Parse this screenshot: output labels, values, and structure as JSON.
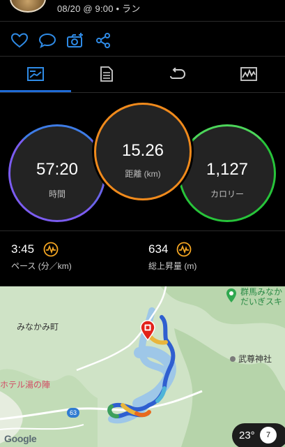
{
  "header": {
    "date_time": "08/20 @ 9:00",
    "activity_type": "ラン",
    "meta_text": "08/20 @ 9:00 • ラン"
  },
  "actions": [
    "like-icon",
    "comment-icon",
    "add-photo-icon",
    "share-icon"
  ],
  "tabs": [
    "overview-icon",
    "details-icon",
    "laps-icon",
    "charts-icon"
  ],
  "summary": {
    "time": {
      "value": "57:20",
      "label": "時間",
      "ring_color": "#7b5cf0"
    },
    "distance": {
      "value": "15.26",
      "label": "距離 (km)",
      "ring_color": "#f08a1c"
    },
    "calories": {
      "value": "1,127",
      "label": "カロリー",
      "ring_color": "#27c43a"
    }
  },
  "metrics": {
    "pace": {
      "value": "3:45",
      "label": "ペース (分／km)"
    },
    "elevation": {
      "value": "634",
      "label": "総上昇量 (m)"
    }
  },
  "map": {
    "labels": {
      "town": "みなかみ町",
      "hotel": "ホテル湯の陣",
      "shrine": "武尊神社",
      "poi_top_line1": "群馬みなか",
      "poi_top_line2": "だいぎスキ",
      "road": "63"
    },
    "google": "Google",
    "weather": {
      "temp": "23°",
      "badge": "7"
    }
  },
  "colors": {
    "accent": "#1e6bd6",
    "metric_icon": "#f5a623"
  }
}
